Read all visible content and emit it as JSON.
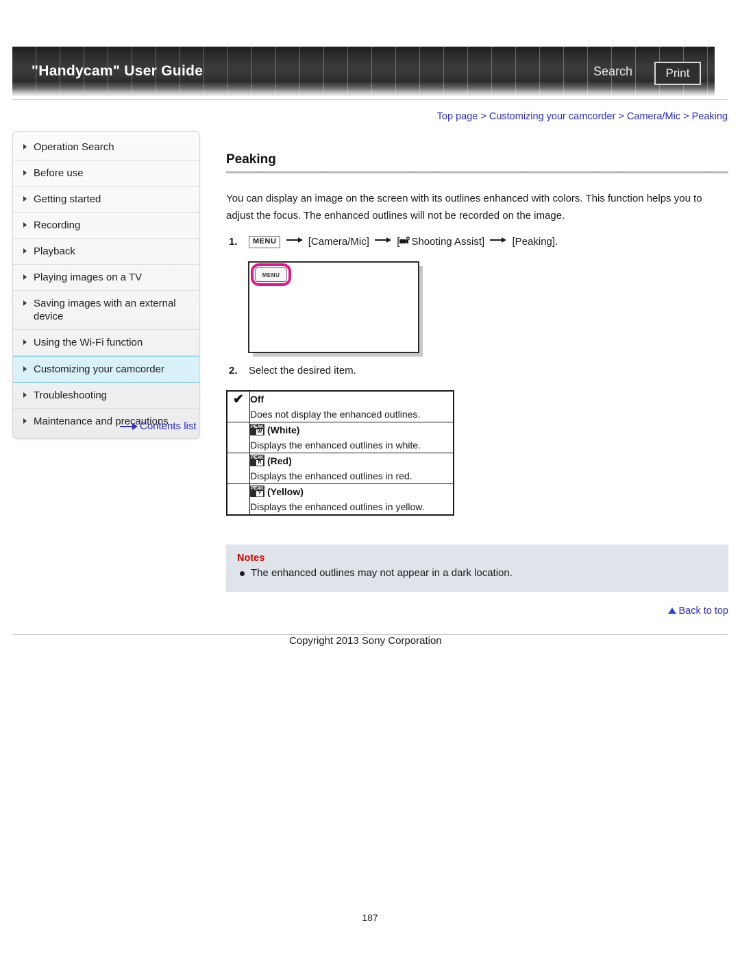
{
  "header": {
    "title": "\"Handycam\" User Guide",
    "search_label": "Search",
    "print_label": "Print"
  },
  "breadcrumb": {
    "text": "Top page > Customizing your camcorder > Camera/Mic > Peaking"
  },
  "sidebar": {
    "items": [
      {
        "label": "Operation Search",
        "active": false
      },
      {
        "label": "Before use",
        "active": false
      },
      {
        "label": "Getting started",
        "active": false
      },
      {
        "label": "Recording",
        "active": false
      },
      {
        "label": "Playback",
        "active": false
      },
      {
        "label": "Playing images on a TV",
        "active": false
      },
      {
        "label": "Saving images with an external device",
        "active": false
      },
      {
        "label": "Using the Wi-Fi function",
        "active": false
      },
      {
        "label": "Customizing your camcorder",
        "active": true
      },
      {
        "label": "Troubleshooting",
        "active": false
      },
      {
        "label": "Maintenance and precautions",
        "active": false
      }
    ],
    "contents_list_label": "Contents list"
  },
  "main": {
    "page_title": "Peaking",
    "intro": "You can display an image on the screen with its outlines enhanced with colors. This function helps you to adjust the focus. The enhanced outlines will not be recorded on the image.",
    "steps": [
      {
        "number": "1.",
        "menu_chip": "MENU",
        "part_camera_mic": "[Camera/Mic]",
        "part_bracket_open": "[",
        "part_shooting_assist": "Shooting Assist]",
        "part_peaking": "[Peaking]."
      },
      {
        "number": "2.",
        "text": "Select the desired item."
      }
    ],
    "illustration": {
      "menu_button_label": "MENU",
      "highlight_color": "#e8138c"
    },
    "options_table": {
      "rows": [
        {
          "check": "✔",
          "icon": null,
          "icon_letter": null,
          "name": "Off",
          "description": "Does not display the enhanced outlines."
        },
        {
          "check": "",
          "icon": "PEAK",
          "icon_letter": "W",
          "name": "(White)",
          "description": "Displays the enhanced outlines in white."
        },
        {
          "check": "",
          "icon": "PEAK",
          "icon_letter": "R",
          "name": "(Red)",
          "description": "Displays the enhanced outlines in red."
        },
        {
          "check": "",
          "icon": "PEAK",
          "icon_letter": "Y",
          "name": "(Yellow)",
          "description": "Displays the enhanced outlines in yellow."
        }
      ]
    },
    "notes": {
      "title": "Notes",
      "items": [
        "The enhanced outlines may not appear in a dark location."
      ]
    },
    "back_to_top_label": "Back to top"
  },
  "footer": {
    "copyright": "Copyright 2013 Sony Corporation",
    "page_number": "187"
  },
  "colors": {
    "link": "#2a2ad0",
    "notes_title": "#d00000",
    "notes_bg": "#dfe3ea",
    "active_bg": "#d9f2fa",
    "highlight": "#e8138c"
  }
}
